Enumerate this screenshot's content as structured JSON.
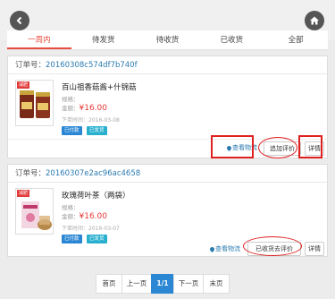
{
  "header": {
    "back_icon": "chevron-left-icon",
    "home_icon": "home-icon"
  },
  "tabs": [
    {
      "label": "一周内",
      "active": true
    },
    {
      "label": "待发货",
      "active": false
    },
    {
      "label": "待收货",
      "active": false
    },
    {
      "label": "已收货",
      "active": false
    },
    {
      "label": "全部",
      "active": false
    }
  ],
  "orders": [
    {
      "order_label": "订单号：",
      "order_no": "20160308c574df7b740f",
      "image_tag": "减肥",
      "product_name": "百山祖香菇酱+什锦菇",
      "spec_label": "规格：",
      "amount_label": "金额：",
      "price": "¥16.00",
      "date": "下单时间：2016-03-08",
      "status_badges": [
        "已付款",
        "已发货"
      ],
      "logistics": "查看物流",
      "actions": [
        "追加评价",
        "详情"
      ]
    },
    {
      "order_label": "订单号：",
      "order_no": "20160307e2ac96ac4658",
      "image_tag": "减肥",
      "product_name": "玫瑰荷叶茶（两袋）",
      "spec_label": "规格：",
      "amount_label": "金额：",
      "price": "¥16.00",
      "date": "下单时间：2016-03-07",
      "status_badges": [
        "已付款",
        "已发货"
      ],
      "logistics": "查看物流",
      "actions": [
        "已收货去评价",
        "详情"
      ]
    }
  ],
  "pagination": {
    "first": "首页",
    "prev": "上一页",
    "current": "1/1",
    "next": "下一页",
    "last": "末页"
  },
  "colors": {
    "accent_red": "#e74c3c",
    "price_red": "#e53935",
    "link_blue": "#2a7ab0",
    "badge_blue": "#2b87d3"
  }
}
